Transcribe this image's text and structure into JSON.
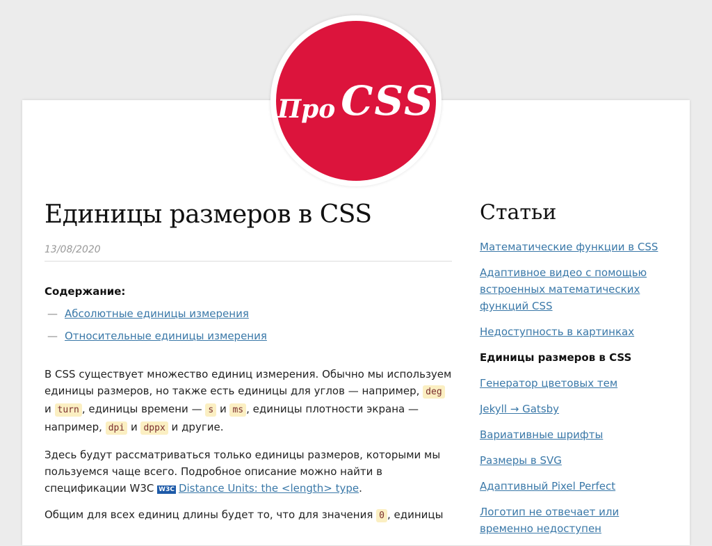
{
  "logo": {
    "pro": "Про",
    "css": "CSS"
  },
  "article": {
    "title": "Единицы размеров в CSS",
    "date": "13/08/2020",
    "toc_title": "Содержание:",
    "toc": [
      {
        "dash": "—",
        "label": "Абсолютные единицы измерения"
      },
      {
        "dash": "—",
        "label": "Относительные единицы измерения"
      }
    ],
    "para1": {
      "t1": "В CSS существует множество единиц измерения. Обычно мы используем единицы размеров, но также есть единицы для углов — например, ",
      "c1": "deg",
      "t2": " и ",
      "c2": "turn",
      "t3": ", единицы времени — ",
      "c3": "s",
      "t4": " и ",
      "c4": "ms",
      "t5": ", единицы плотности экрана — например, ",
      "c5": "dpi",
      "t6": " и ",
      "c6": "dppx",
      "t7": " и другие."
    },
    "para2": {
      "t1": "Здесь будут рассматриваться только единицы размеров, которыми мы пользуемся чаще всего. Подробное описание можно найти в спецификации W3C ",
      "badge": "W3C",
      "link": "Distance Units: the <length> type",
      "t2": "."
    },
    "para3": {
      "t1": "Общим для всех единиц длины будет то, что для значения ",
      "c1": "0",
      "t2": ", единицы"
    }
  },
  "sidebar": {
    "title": "Статьи",
    "items": [
      {
        "label": "Математические функции в CSS",
        "current": false
      },
      {
        "label": "Адаптивное видео с помощью встроенных математических функций CSS",
        "current": false
      },
      {
        "label": "Недоступность в картинках",
        "current": false
      },
      {
        "label": "Единицы размеров в CSS",
        "current": true
      },
      {
        "label": "Генератор цветовых тем",
        "current": false
      },
      {
        "label": "Jekyll → Gatsby",
        "current": false
      },
      {
        "label": "Вариативные шрифты",
        "current": false
      },
      {
        "label": "Размеры в SVG",
        "current": false
      },
      {
        "label": "Адаптивный Pixel Perfect",
        "current": false
      },
      {
        "label": "Логотип не отвечает или временно недоступен",
        "current": false
      }
    ]
  },
  "colors": {
    "brand": "#dc143c",
    "link": "#3a78a8",
    "code_bg": "#fbefc2"
  }
}
